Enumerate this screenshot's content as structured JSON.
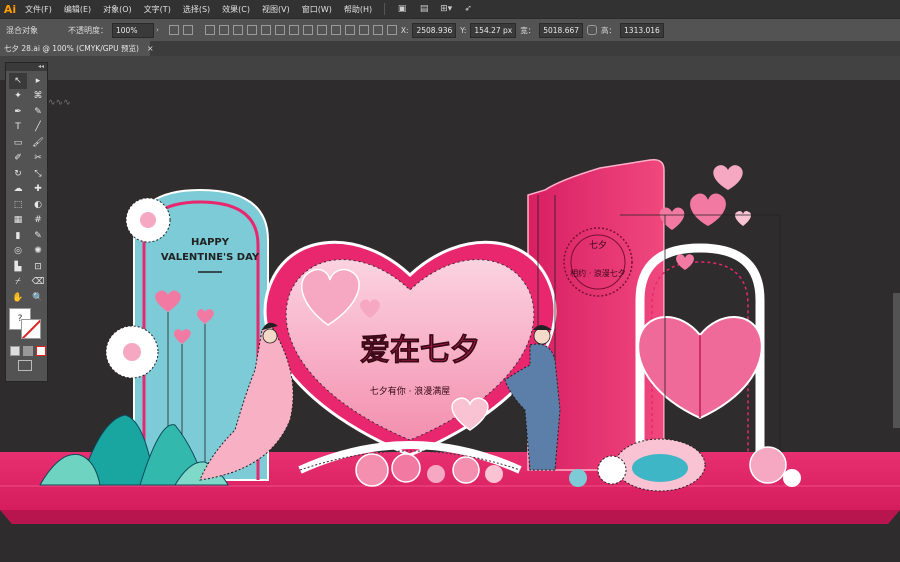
{
  "app": {
    "logo": "Ai"
  },
  "menu": [
    {
      "label": "文件(F)"
    },
    {
      "label": "编辑(E)"
    },
    {
      "label": "对象(O)"
    },
    {
      "label": "文字(T)"
    },
    {
      "label": "选择(S)"
    },
    {
      "label": "效果(C)"
    },
    {
      "label": "视图(V)"
    },
    {
      "label": "窗口(W)"
    },
    {
      "label": "帮助(H)"
    }
  ],
  "control": {
    "selection_label": "混合对象",
    "opacity_label": "不透明度：",
    "opacity_value": "100%",
    "x_label": "X:",
    "x_value": "2508.936",
    "y_label": "Y:",
    "y_value": "154.27 px",
    "w_label": "宽：",
    "w_value": "5018.667",
    "h_label": "高：",
    "h_value": "1313.016"
  },
  "document": {
    "tab_title": "七夕 28.ai @ 100% (CMYK/GPU 预览)",
    "close": "×"
  },
  "toolbox": {
    "collapse": "◂◂",
    "tools": [
      {
        "name": "selection-tool",
        "glyph": "↖",
        "active": true
      },
      {
        "name": "direct-selection-tool",
        "glyph": "▸"
      },
      {
        "name": "magic-wand-tool",
        "glyph": "✦"
      },
      {
        "name": "lasso-tool",
        "glyph": "⌘"
      },
      {
        "name": "pen-tool",
        "glyph": "✒"
      },
      {
        "name": "curvature-tool",
        "glyph": "✎"
      },
      {
        "name": "type-tool",
        "glyph": "T"
      },
      {
        "name": "line-tool",
        "glyph": "╱"
      },
      {
        "name": "rectangle-tool",
        "glyph": "▭"
      },
      {
        "name": "paintbrush-tool",
        "glyph": "🖌"
      },
      {
        "name": "shaper-tool",
        "glyph": "✐"
      },
      {
        "name": "scissors-tool",
        "glyph": "✂"
      },
      {
        "name": "rotate-tool",
        "glyph": "↻"
      },
      {
        "name": "scale-tool",
        "glyph": "⤡"
      },
      {
        "name": "warp-tool",
        "glyph": "☁"
      },
      {
        "name": "puppet-warp-tool",
        "glyph": "✚"
      },
      {
        "name": "free-transform-tool",
        "glyph": "⬚"
      },
      {
        "name": "shape-builder-tool",
        "glyph": "◐"
      },
      {
        "name": "perspective-grid-tool",
        "glyph": "▦"
      },
      {
        "name": "mesh-tool",
        "glyph": "#"
      },
      {
        "name": "gradient-tool",
        "glyph": "▮"
      },
      {
        "name": "eyedropper-tool",
        "glyph": "✎"
      },
      {
        "name": "blend-tool",
        "glyph": "◎"
      },
      {
        "name": "symbol-sprayer-tool",
        "glyph": "✺"
      },
      {
        "name": "column-graph-tool",
        "glyph": "▙"
      },
      {
        "name": "artboard-tool",
        "glyph": "⊡"
      },
      {
        "name": "slice-tool",
        "glyph": "⌿"
      },
      {
        "name": "eraser-tool",
        "glyph": "⌫"
      },
      {
        "name": "hand-tool",
        "glyph": "✋"
      },
      {
        "name": "zoom-tool",
        "glyph": "🔍"
      }
    ],
    "fill_stroke_label": "?"
  },
  "artwork": {
    "colors": {
      "canvas": "#2f2c2d",
      "pink": "#e8276f",
      "lightpink": "#f7b9cb",
      "cyan": "#7ccbd6",
      "floor": "#e3246a",
      "floorDark": "#b8154f"
    },
    "arch_text_1": "HAPPY",
    "arch_text_2": "VALENTINE'S DAY",
    "title_text": "爱在七夕",
    "subtitle_text": "七夕有你 · 浪漫满屋",
    "right_text_1": "七夕",
    "right_text_2": "相约 · 浪漫七夕"
  }
}
